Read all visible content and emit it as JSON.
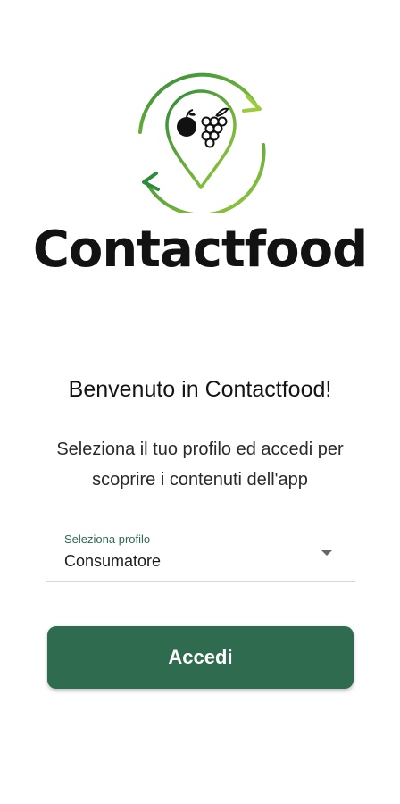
{
  "brand": {
    "name": "Contactfood",
    "logo_icon": "pin-with-fruit-recycle-arrows-icon"
  },
  "welcome": {
    "title": "Benvenuto in Contactfood!",
    "subtitle": "Seleziona il tuo profilo ed accedi per scoprire i contenuti dell'app"
  },
  "profile_select": {
    "label": "Seleziona profilo",
    "value": "Consumatore"
  },
  "login": {
    "label": "Accedi"
  },
  "colors": {
    "primary": "#2e6b4f",
    "logo_green_dark": "#2f8a3a",
    "logo_green_light": "#9ccc3c"
  }
}
